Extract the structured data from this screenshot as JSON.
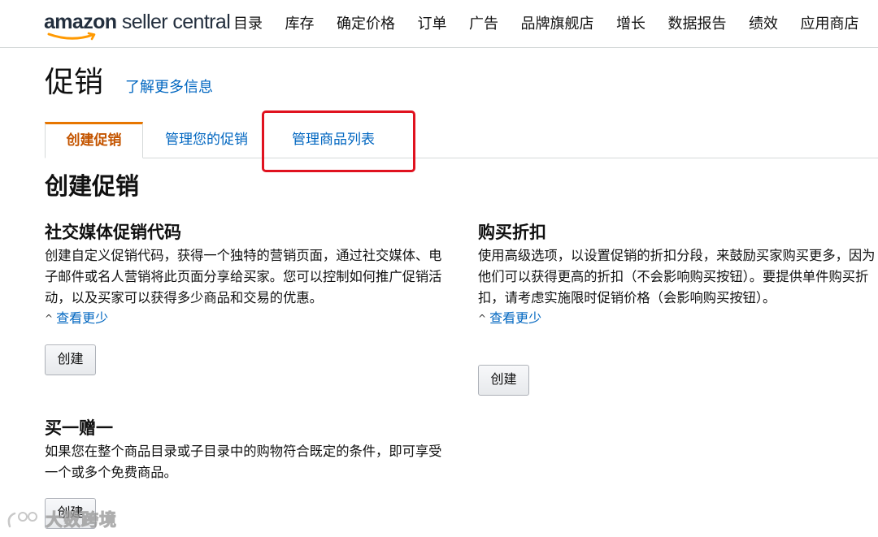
{
  "brand": {
    "logo_amazon": "amazon",
    "logo_rest": " seller central",
    "accent_color": "#e77600",
    "link_color": "#0066c0"
  },
  "nav": {
    "items": [
      {
        "label": "目录"
      },
      {
        "label": "库存"
      },
      {
        "label": "确定价格"
      },
      {
        "label": "订单"
      },
      {
        "label": "广告"
      },
      {
        "label": "品牌旗舰店"
      },
      {
        "label": "增长"
      },
      {
        "label": "数据报告"
      },
      {
        "label": "绩效"
      },
      {
        "label": "应用商店"
      }
    ]
  },
  "header": {
    "title": "促销",
    "learn_more": "了解更多信息"
  },
  "tabs": [
    {
      "label": "创建促销",
      "active": true
    },
    {
      "label": "管理您的促销",
      "active": false
    },
    {
      "label": "管理商品列表",
      "active": false
    }
  ],
  "highlight_color": "#e0121f",
  "section": {
    "title": "创建促销"
  },
  "cards": {
    "social": {
      "title": "社交媒体促销代码",
      "desc": "创建自定义促销代码，获得一个独特的营销页面，通过社交媒体、电子邮件或名人营销将此页面分享给买家。您可以控制如何推广促销活动，以及买家可以获得多少商品和交易的优惠。",
      "see_less": "查看更少",
      "button": "创建"
    },
    "discount": {
      "title": "购买折扣",
      "desc": "使用高级选项，以设置促销的折扣分段，来鼓励买家购买更多，因为他们可以获得更高的折扣（不会影响购买按钮）。要提供单件购买折扣，请考虑实施限时促销价格（会影响购买按钮）。",
      "see_less": "查看更少",
      "button": "创建"
    },
    "bogo": {
      "title": "买一赠一",
      "desc": "如果您在整个商品目录或子目录中的购物符合既定的条件，即可享受一个或多个免费商品。",
      "button": "创建"
    }
  },
  "watermark": {
    "text": "大数跨境"
  }
}
